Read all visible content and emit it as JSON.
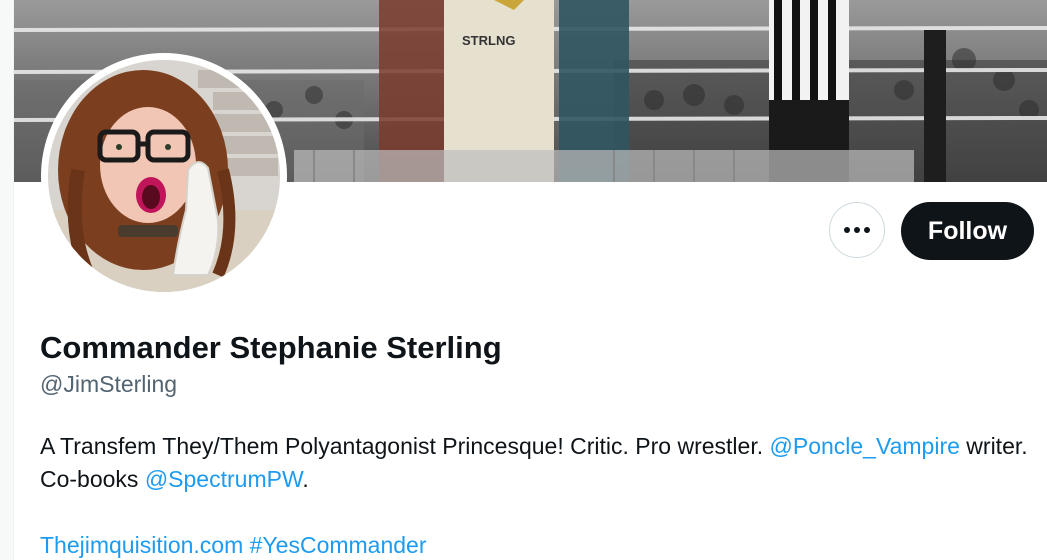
{
  "profile": {
    "display_name": "Commander Stephanie Sterling",
    "handle": "@JimSterling",
    "bio": {
      "part1": "A Transfem They/Them Polyantagonist Princesque! Critic. Pro wrestler. ",
      "mention1": "@Poncle_Vampire",
      "part2": " writer. Co-books ",
      "mention2": "@SpectrumPW",
      "part3": "."
    },
    "website": "Thejimquisition.com",
    "hashtag": "#YesCommander"
  },
  "actions": {
    "more_icon": "more-horizontal-icon",
    "follow_label": "Follow"
  },
  "banner": {
    "description_icon": "wrestling-ring-banner"
  },
  "colors": {
    "link": "#1d9bf0",
    "text": "#0f1419",
    "secondary": "#536471",
    "follow_bg": "#0f1419"
  }
}
